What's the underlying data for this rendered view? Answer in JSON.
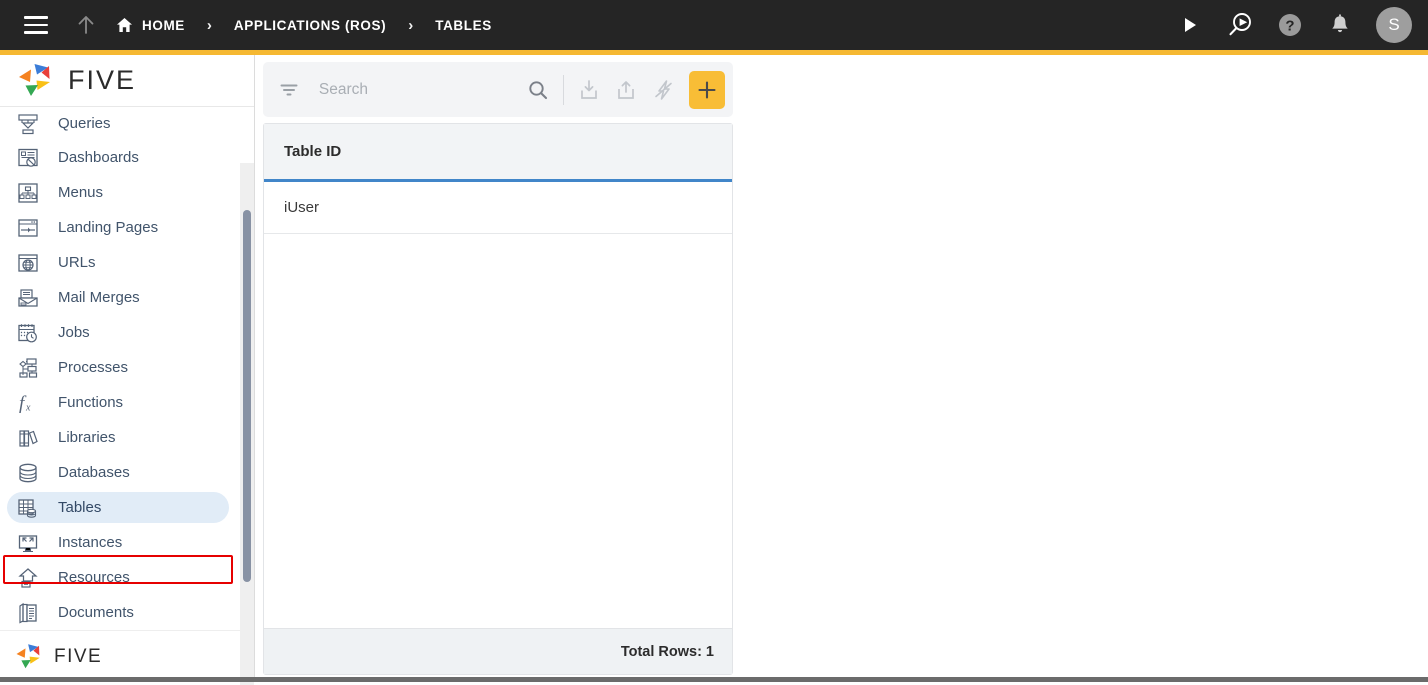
{
  "topbar": {
    "menu_icon": "hamburger-icon",
    "up_icon": "arrow-up-icon",
    "breadcrumbs": [
      {
        "label": "HOME",
        "icon": "home-icon"
      },
      {
        "label": "APPLICATIONS (ROS)",
        "icon": ""
      },
      {
        "label": "TABLES",
        "icon": ""
      }
    ],
    "separator": "›",
    "actions": [
      {
        "name": "run-icon",
        "title": "Run"
      },
      {
        "name": "debug-search-icon",
        "title": "Debug"
      },
      {
        "name": "help-icon",
        "title": "Help"
      },
      {
        "name": "notifications-bell-icon",
        "title": "Notifications"
      }
    ],
    "avatar_initial": "S",
    "accent_color": "#f5b832",
    "background_color": "#252525"
  },
  "sidebar": {
    "logo_text": "FIVE",
    "footer_logo_text": "FIVE",
    "items": [
      {
        "label": "Queries",
        "icon": "queries-icon",
        "active": false
      },
      {
        "label": "Dashboards",
        "icon": "dashboards-icon",
        "active": false
      },
      {
        "label": "Menus",
        "icon": "menus-icon",
        "active": false
      },
      {
        "label": "Landing Pages",
        "icon": "landing-pages-icon",
        "active": false
      },
      {
        "label": "URLs",
        "icon": "urls-globe-icon",
        "active": false
      },
      {
        "label": "Mail Merges",
        "icon": "mail-merges-icon",
        "active": false
      },
      {
        "label": "Jobs",
        "icon": "jobs-calendar-clock-icon",
        "active": false
      },
      {
        "label": "Processes",
        "icon": "processes-flow-icon",
        "active": false
      },
      {
        "label": "Functions",
        "icon": "functions-fx-icon",
        "active": false
      },
      {
        "label": "Libraries",
        "icon": "libraries-books-icon",
        "active": false
      },
      {
        "label": "Databases",
        "icon": "databases-cylinder-icon",
        "active": false
      },
      {
        "label": "Tables",
        "icon": "tables-grid-icon",
        "active": true
      },
      {
        "label": "Instances",
        "icon": "instances-monitor-icon",
        "active": false
      },
      {
        "label": "Resources",
        "icon": "resources-upload-icon",
        "active": false
      },
      {
        "label": "Documents",
        "icon": "documents-pages-icon",
        "active": false
      }
    ],
    "highlight_color": "#e1ecf7",
    "annotation_box_color": "#e60000"
  },
  "toolbar": {
    "filter_icon": "filter-icon",
    "search_placeholder": "Search",
    "search_value": "",
    "search_icon": "search-magnifier-icon",
    "import_icon": "import-download-icon",
    "export_icon": "export-share-icon",
    "quick_action_icon": "lightning-bolt-icon",
    "add_label": "+",
    "add_icon": "plus-icon",
    "add_color": "#f8bd36"
  },
  "grid": {
    "columns": [
      "Table ID"
    ],
    "rows": [
      {
        "table_id": "iUser"
      }
    ],
    "header_underline_color": "#4186c9",
    "footer_total": "Total Rows: 1"
  }
}
